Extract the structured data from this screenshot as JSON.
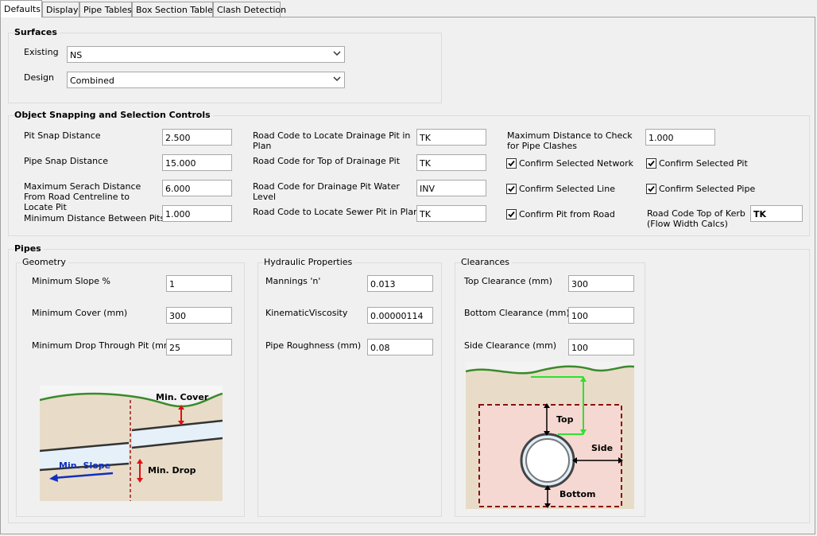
{
  "tabs": [
    {
      "label": "Defaults"
    },
    {
      "label": "Display"
    },
    {
      "label": "Pipe Tables"
    },
    {
      "label": "Box Section Tables"
    },
    {
      "label": "Clash Detection"
    }
  ],
  "surfaces": {
    "title": "Surfaces",
    "existing_label": "Existing",
    "existing_value": "NS",
    "design_label": "Design",
    "design_value": "Combined"
  },
  "snapping": {
    "title": "Object Snapping and Selection Controls",
    "pit_snap_label": "Pit Snap Distance",
    "pit_snap_value": "2.500",
    "pipe_snap_label": "Pipe Snap Distance",
    "pipe_snap_value": "15.000",
    "max_search_label": "Maximum Serach Distance From Road Centreline to Locate Pit",
    "max_search_value": "6.000",
    "min_dist_label": "Minimum Distance Between Pits",
    "min_dist_value": "1.000",
    "rc_locate_label": "Road Code to Locate Drainage Pit in Plan",
    "rc_locate_value": "TK",
    "rc_top_label": "Road Code for Top of Drainage Pit",
    "rc_top_value": "TK",
    "rc_water_label": "Road Code for Drainage Pit Water Level",
    "rc_water_value": "INV",
    "rc_sewer_label": "Road Code to Locate Sewer Pit in Plan",
    "rc_sewer_value": "TK",
    "max_clash_label": "Maximum Distance to Check for Pipe Clashes",
    "max_clash_value": "1.000",
    "confirm_network": "Confirm Selected Network",
    "confirm_pit": "Confirm Selected Pit",
    "confirm_line": "Confirm Selected Line",
    "confirm_pipe": "Confirm Selected Pipe",
    "confirm_pit_road": "Confirm Pit from Road",
    "kerb_label": "Road Code Top of Kerb (Flow Width Calcs)",
    "kerb_value": "TK"
  },
  "pipes": {
    "title": "Pipes",
    "geometry": {
      "title": "Geometry",
      "min_slope_label": "Minimum Slope %",
      "min_slope_value": "1",
      "min_cover_label": "Minimum Cover (mm)",
      "min_cover_value": "300",
      "min_drop_label": "Minimum Drop Through Pit (mm)",
      "min_drop_value": "25",
      "ill_cover": "Min. Cover",
      "ill_slope": "Min. Slope",
      "ill_drop": "Min. Drop"
    },
    "hydraulic": {
      "title": "Hydraulic Properties",
      "mannings_label": "Mannings 'n'",
      "mannings_value": "0.013",
      "kinematic_label": "KinematicViscosity",
      "kinematic_value": "0.00000114",
      "roughness_label": "Pipe Roughness (mm)",
      "roughness_value": "0.08"
    },
    "clearances": {
      "title": "Clearances",
      "top_label": "Top Clearance (mm)",
      "top_value": "300",
      "bottom_label": "Bottom Clearance (mm)",
      "bottom_value": "100",
      "side_label": "Side Clearance (mm)",
      "side_value": "100",
      "ill_top": "Top",
      "ill_side": "Side",
      "ill_bottom": "Bottom"
    }
  },
  "icons": {
    "dropdown": "chevron-down-icon",
    "check": "check-icon"
  },
  "colors": {
    "ground_line": "#3a8a2a",
    "arrow_red": "#e01010",
    "arrow_blue": "#1030c0",
    "arrow_green": "#30e030",
    "clearance_box": "#8a1010"
  }
}
